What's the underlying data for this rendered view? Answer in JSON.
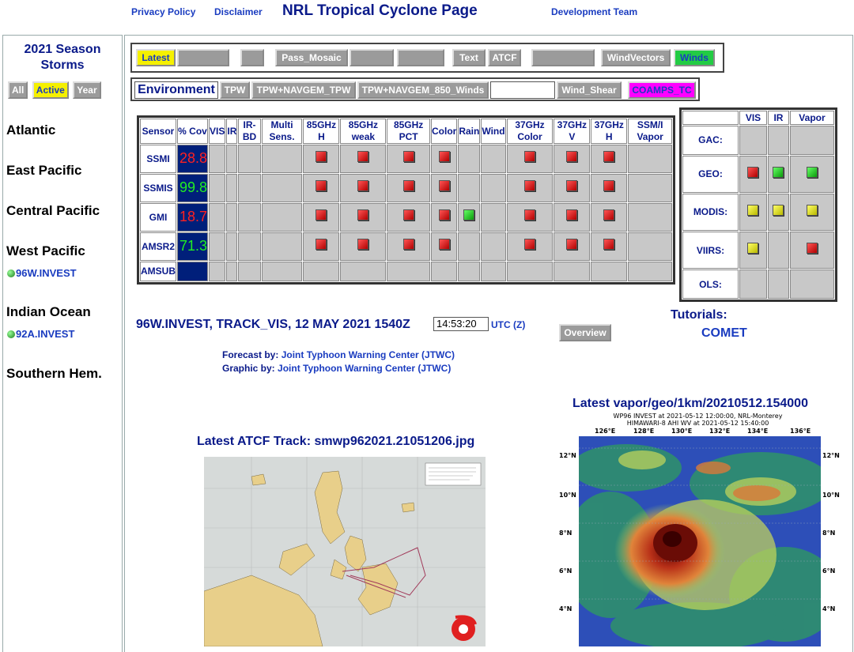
{
  "top": {
    "privacy": "Privacy Policy",
    "disclaimer": "Disclaimer",
    "title": "NRL Tropical Cyclone Page",
    "devteam": "Development Team"
  },
  "sidebar": {
    "season_line1": "2021 Season",
    "season_line2": "Storms",
    "buttons": [
      "All",
      "Active",
      "Year"
    ],
    "basins": [
      "Atlantic",
      "East Pacific",
      "Central Pacific",
      "West Pacific",
      "Indian Ocean",
      "Southern Hem."
    ],
    "invests": [
      "96W.INVEST",
      "92A.INVEST"
    ]
  },
  "products": {
    "row1": [
      "Latest",
      "Pass_Mosaic",
      "Text",
      "ATCF",
      "WindVectors",
      "Winds"
    ],
    "env_label": "Environment",
    "row2": [
      "TPW",
      "TPW+NAVGEM_TPW",
      "TPW+NAVGEM_850_Winds",
      "Wind_Shear",
      "COAMPS_TC"
    ]
  },
  "sensor_table": {
    "headers": [
      "Sensor",
      "% Cov",
      "VIS",
      "IR",
      "IR-BD",
      "Multi Sens.",
      "85GHz H",
      "85GHz weak",
      "85GHz PCT",
      "Color",
      "Rain",
      "Wind",
      "37GHz Color",
      "37GHz V",
      "37GHz H",
      "SSM/I Vapor"
    ],
    "rows": [
      {
        "sensor": "SSMI",
        "cov": "28.8",
        "cov_color": "#ff2020",
        "marks": [
          "",
          "",
          "",
          "",
          "r",
          "r",
          "r",
          "r",
          "",
          "",
          "r",
          "r",
          "r",
          ""
        ]
      },
      {
        "sensor": "SSMIS",
        "cov": "99.8",
        "cov_color": "#22ee22",
        "marks": [
          "",
          "",
          "",
          "",
          "r",
          "r",
          "r",
          "r",
          "",
          "",
          "r",
          "r",
          "r",
          ""
        ]
      },
      {
        "sensor": "GMI",
        "cov": "18.7",
        "cov_color": "#ff2020",
        "marks": [
          "",
          "",
          "",
          "",
          "r",
          "r",
          "r",
          "r",
          "g",
          "",
          "r",
          "r",
          "r",
          ""
        ]
      },
      {
        "sensor": "AMSR2",
        "cov": "71.3",
        "cov_color": "#22ee22",
        "marks": [
          "",
          "",
          "",
          "",
          "r",
          "r",
          "r",
          "r",
          "",
          "",
          "r",
          "r",
          "r",
          ""
        ]
      },
      {
        "sensor": "AMSUB",
        "cov": "",
        "cov_color": "#22ee22",
        "marks": [
          "",
          "",
          "",
          "",
          "",
          "",
          "",
          "",
          "",
          "",
          "",
          "",
          "",
          ""
        ]
      }
    ]
  },
  "geo_table": {
    "headers": [
      "VIS",
      "IR",
      "Vapor"
    ],
    "rows": [
      {
        "name": "GAC:",
        "marks": [
          "",
          "",
          ""
        ]
      },
      {
        "name": "GEO:",
        "marks": [
          "r",
          "g",
          "g"
        ]
      },
      {
        "name": "MODIS:",
        "marks": [
          "y",
          "y",
          "y"
        ]
      },
      {
        "name": "VIIRS:",
        "marks": [
          "y",
          "",
          "r"
        ]
      },
      {
        "name": "OLS:",
        "marks": [
          "",
          "",
          ""
        ]
      }
    ]
  },
  "storm": {
    "info": "96W.INVEST, TRACK_VIS,  12 MAY 2021 1540Z",
    "time": "14:53:20",
    "utc": "UTC (Z)",
    "overview": "Overview",
    "tutorials": "Tutorials:",
    "comet": "COMET",
    "forecast_label": "Forecast by:",
    "forecast_by": "Joint Typhoon Warning Center (JTWC)",
    "graphic_label": "Graphic by:",
    "graphic_by": "Joint Typhoon Warning Center (JTWC)"
  },
  "images": {
    "track_title": "Latest ATCF Track: smwp962021.21051206.jpg",
    "vapor_title": "Latest vapor/geo/1km/20210512.154000",
    "vapor_sub1": "WP96 INVEST at 2021-05-12 12:00:00, NRL-Monterey",
    "vapor_sub2": "HIMAWARI-8 AHI WV at 2021-05-12 15:40:00",
    "lon_labels": [
      "126°E",
      "128°E",
      "130°E",
      "132°E",
      "134°E",
      "136°E"
    ],
    "lat_labels": [
      "12°N",
      "10°N",
      "8°N",
      "6°N",
      "4°N"
    ]
  }
}
